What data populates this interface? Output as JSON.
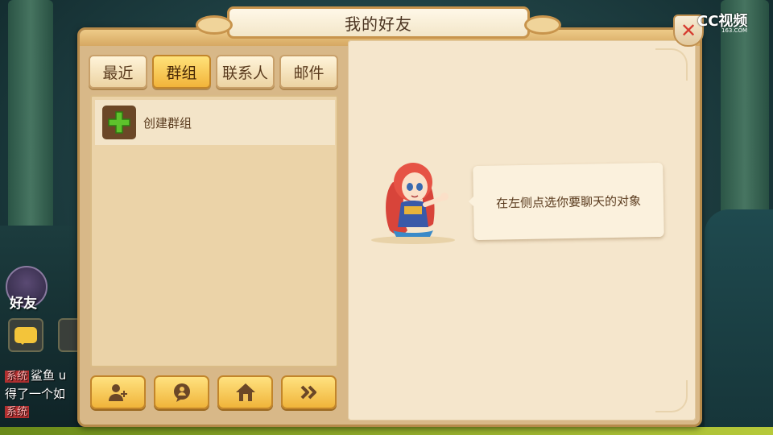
{
  "window": {
    "title": "我的好友"
  },
  "tabs": [
    {
      "label": "最近",
      "active": false
    },
    {
      "label": "群组",
      "active": true
    },
    {
      "label": "联系人",
      "active": false
    },
    {
      "label": "邮件",
      "active": false
    }
  ],
  "group_list": {
    "items": [
      {
        "label": "创建群组",
        "icon": "plus-icon"
      }
    ]
  },
  "bottom_buttons": [
    {
      "icon": "add-friend-icon"
    },
    {
      "icon": "chat-bubble-icon"
    },
    {
      "icon": "home-icon"
    },
    {
      "icon": "double-arrow-right-icon"
    }
  ],
  "chat_area": {
    "prompt": "在左侧点选你要聊天的对象"
  },
  "close_button": {
    "icon": "close-icon"
  },
  "watermark": {
    "text": "CC视频",
    "sub": "163.COM"
  },
  "hud": {
    "friend_label": "好友",
    "chat_lines": [
      {
        "tag": "系统",
        "text": "鲨鱼 u"
      },
      {
        "tag": "",
        "text": "得了一个如"
      },
      {
        "tag": "系统",
        "text": ""
      }
    ]
  },
  "colors": {
    "tab_active": "#f2b43a",
    "panel": "#d8b888",
    "plus_green": "#5ec22c",
    "close_red": "#d63b2f"
  }
}
